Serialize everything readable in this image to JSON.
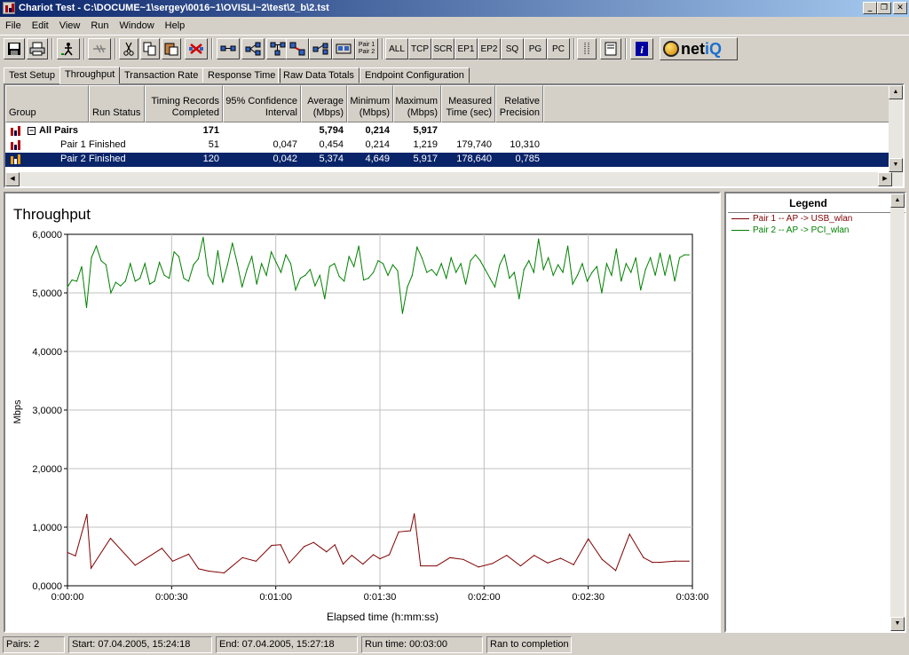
{
  "window": {
    "title": "Chariot Test - C:\\DOCUME~1\\sergey\\0016~1\\OVISLI~2\\test\\2_b\\2.tst",
    "min_icon": "minimize-icon",
    "restore_icon": "restore-icon",
    "close_icon": "close-icon"
  },
  "menu": [
    "File",
    "Edit",
    "View",
    "Run",
    "Window",
    "Help"
  ],
  "toolbar": {
    "pair_label_top": "Pair 1",
    "pair_label_bottom": "Pair 2",
    "filters": [
      "ALL",
      "TCP",
      "SCR",
      "EP1",
      "EP2",
      "SQ",
      "PG",
      "PC"
    ],
    "logo_net": "net",
    "logo_iq": "iQ"
  },
  "tabs": [
    "Test Setup",
    "Throughput",
    "Transaction Rate",
    "Response Time",
    "Raw Data Totals",
    "Endpoint Configuration"
  ],
  "table": {
    "headers": {
      "group": "Group",
      "run_status": "Run Status",
      "timing_1": "Timing Records",
      "timing_2": "Completed",
      "conf_1": "95% Confidence",
      "conf_2": "Interval",
      "avg_1": "Average",
      "avg_2": "(Mbps)",
      "min_1": "Minimum",
      "min_2": "(Mbps)",
      "max_1": "Maximum",
      "max_2": "(Mbps)",
      "mt_1": "Measured",
      "mt_2": "Time (sec)",
      "rp_1": "Relative",
      "rp_2": "Precision"
    },
    "all_pairs": {
      "expand": "−",
      "group": "All Pairs",
      "records": "171",
      "average": "5,794",
      "minimum": "0,214",
      "maximum": "5,917"
    },
    "rows": [
      {
        "group": "Pair 1",
        "status": "Finished",
        "records": "51",
        "confidence": "0,047",
        "average": "0,454",
        "minimum": "0,214",
        "maximum": "1,219",
        "measured": "179,740",
        "precision": "10,310"
      },
      {
        "group": "Pair 2",
        "status": "Finished",
        "records": "120",
        "confidence": "0,042",
        "average": "5,374",
        "minimum": "4,649",
        "maximum": "5,917",
        "measured": "178,640",
        "precision": "0,785"
      }
    ]
  },
  "legend": {
    "title": "Legend",
    "items": [
      {
        "label": "Pair 1 -- AP -> USB_wlan",
        "color": "#800000"
      },
      {
        "label": "Pair 2 -- AP -> PCI_wlan",
        "color": "#008000"
      }
    ]
  },
  "status": {
    "pairs": "Pairs: 2",
    "start": "Start: 07.04.2005, 15:24:18",
    "end": "End: 07.04.2005, 15:27:18",
    "runtime": "Run time: 00:03:00",
    "result": "Ran to completion"
  },
  "chart_data": {
    "type": "line",
    "title": "Throughput",
    "xlabel": "Elapsed time (h:mm:ss)",
    "ylabel": "Mbps",
    "ylim": [
      0,
      6
    ],
    "xlim": [
      0,
      180
    ],
    "x_ticks": [
      "0:00:00",
      "0:00:30",
      "0:01:00",
      "0:01:30",
      "0:02:00",
      "0:02:30",
      "0:03:00"
    ],
    "y_ticks": [
      "0,0000",
      "1,0000",
      "2,0000",
      "3,0000",
      "4,0000",
      "5,0000",
      "6,0000"
    ],
    "grid": true,
    "series": [
      {
        "name": "Pair 1 -- AP -> USB_wlan",
        "color": "#800000",
        "x": [
          0,
          2.3,
          5.6,
          6.8,
          12.4,
          19.5,
          27.2,
          30.3,
          34.9,
          37.8,
          40.7,
          45.1,
          50.4,
          54.3,
          58.8,
          61.4,
          63.9,
          68.2,
          70.9,
          74.6,
          77.0,
          79.4,
          81.9,
          85.1,
          88.1,
          90.0,
          92.7,
          95.4,
          98.8,
          99.9,
          100.8,
          101.7,
          106.3,
          110.2,
          114.0,
          118.4,
          122.4,
          126.5,
          130.5,
          134.4,
          138.3,
          142.0,
          145.8,
          150.0,
          154.0,
          157.9,
          161.9,
          165.9,
          168.5,
          170.5,
          175.0,
          179.0
        ],
        "values": [
          0.57,
          0.51,
          1.22,
          0.3,
          0.81,
          0.35,
          0.64,
          0.42,
          0.54,
          0.29,
          0.25,
          0.22,
          0.48,
          0.42,
          0.69,
          0.7,
          0.39,
          0.67,
          0.74,
          0.58,
          0.7,
          0.37,
          0.52,
          0.37,
          0.53,
          0.46,
          0.53,
          0.92,
          0.94,
          1.23,
          0.8,
          0.34,
          0.34,
          0.48,
          0.45,
          0.32,
          0.38,
          0.52,
          0.34,
          0.52,
          0.39,
          0.47,
          0.36,
          0.8,
          0.45,
          0.26,
          0.88,
          0.48,
          0.4,
          0.4,
          0.42,
          0.42
        ]
      },
      {
        "name": "Pair 2 -- AP -> PCI_wlan",
        "color": "#008000",
        "x": [
          0,
          1.3,
          2.7,
          4.1,
          5.5,
          6.9,
          8.3,
          9.7,
          11.1,
          12.5,
          13.9,
          15.3,
          16.7,
          18.1,
          19.5,
          20.9,
          22.3,
          23.7,
          25.1,
          26.5,
          27.9,
          29.3,
          30.7,
          32.1,
          33.5,
          34.9,
          36.3,
          37.7,
          39.1,
          40.5,
          41.9,
          43.3,
          44.7,
          46.1,
          47.5,
          48.9,
          50.3,
          51.7,
          53.1,
          54.5,
          55.9,
          57.3,
          58.7,
          60.1,
          61.5,
          62.9,
          64.3,
          65.7,
          67.1,
          68.5,
          69.9,
          71.3,
          72.7,
          74.1,
          75.5,
          76.9,
          78.3,
          79.7,
          81.1,
          82.5,
          83.9,
          85.3,
          86.7,
          88.1,
          89.5,
          90.9,
          92.3,
          93.7,
          95.1,
          96.5,
          97.9,
          99.3,
          100.7,
          102.1,
          103.5,
          104.9,
          106.3,
          107.7,
          109.1,
          110.5,
          111.9,
          113.3,
          114.7,
          116.1,
          117.5,
          118.9,
          120.3,
          121.7,
          123.1,
          124.5,
          125.9,
          127.3,
          128.7,
          130.1,
          131.5,
          132.9,
          134.3,
          135.7,
          137.1,
          138.5,
          139.9,
          141.3,
          142.7,
          144.1,
          145.5,
          146.9,
          148.3,
          149.7,
          151.1,
          152.5,
          153.9,
          155.3,
          156.7,
          158.1,
          159.5,
          160.9,
          162.3,
          163.7,
          165.1,
          166.5,
          167.9,
          169.3,
          170.7,
          172.1,
          173.5,
          174.9,
          176.3,
          177.7,
          179.0
        ],
        "values": [
          5.1,
          5.22,
          5.2,
          5.45,
          4.75,
          5.6,
          5.8,
          5.55,
          5.48,
          5.0,
          5.18,
          5.12,
          5.2,
          5.5,
          5.2,
          5.25,
          5.5,
          5.15,
          5.2,
          5.52,
          5.3,
          5.25,
          5.7,
          5.62,
          5.25,
          5.2,
          5.48,
          5.58,
          5.95,
          5.3,
          5.15,
          5.72,
          5.18,
          5.48,
          5.85,
          5.5,
          5.1,
          5.4,
          5.62,
          5.15,
          5.5,
          5.3,
          5.7,
          5.52,
          5.35,
          5.65,
          5.5,
          5.05,
          5.25,
          5.3,
          5.4,
          5.12,
          5.3,
          4.9,
          5.45,
          5.5,
          5.28,
          5.2,
          5.62,
          5.45,
          5.8,
          5.22,
          5.25,
          5.35,
          5.55,
          5.5,
          5.3,
          5.48,
          5.38,
          4.65,
          5.1,
          5.3,
          5.78,
          5.6,
          5.35,
          5.4,
          5.3,
          5.5,
          5.25,
          5.6,
          5.35,
          5.5,
          5.15,
          5.55,
          5.65,
          5.55,
          5.4,
          5.25,
          5.1,
          5.48,
          5.65,
          5.25,
          5.35,
          4.9,
          5.4,
          5.55,
          5.35,
          5.92,
          5.4,
          5.6,
          5.3,
          5.48,
          5.35,
          5.8,
          5.15,
          5.3,
          5.5,
          5.2,
          5.35,
          5.45,
          5.0,
          5.5,
          5.3,
          5.75,
          5.2,
          5.5,
          5.35,
          5.6,
          5.05,
          5.4,
          5.6,
          5.3,
          5.68,
          5.3,
          5.65,
          5.2,
          5.6,
          5.65,
          5.65
        ]
      }
    ]
  }
}
